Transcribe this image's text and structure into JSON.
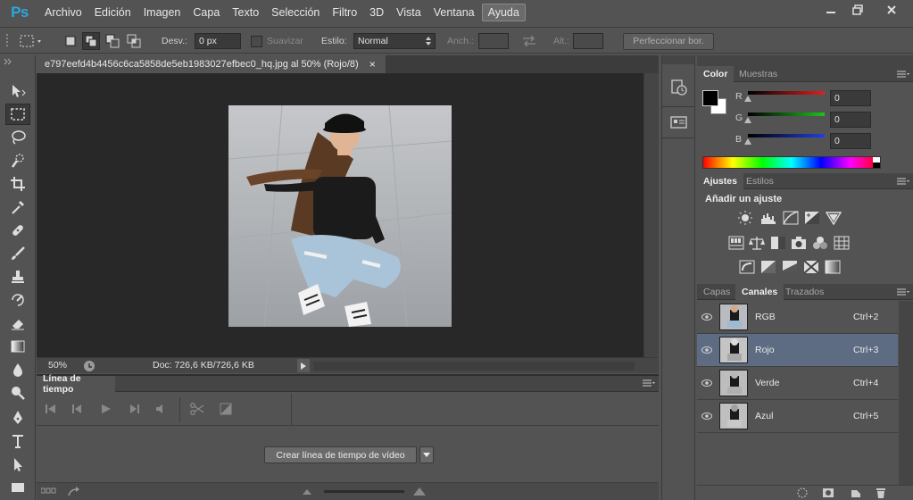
{
  "app": {
    "logo": "Ps"
  },
  "menu": [
    "Archivo",
    "Edición",
    "Imagen",
    "Capa",
    "Texto",
    "Selección",
    "Filtro",
    "3D",
    "Vista",
    "Ventana",
    "Ayuda"
  ],
  "menu_active": "Ayuda",
  "options": {
    "desv_label": "Desv.:",
    "desv_value": "0 px",
    "suavizar_label": "Suavizar",
    "estilo_label": "Estilo:",
    "estilo_value": "Normal",
    "anch_label": "Anch.:",
    "alt_label": "Alt.:",
    "refine_label": "Perfeccionar bor."
  },
  "document": {
    "tab_title": "e797eefd4b4456c6ca5858de5eb1983027efbec0_hq.jpg al 50% (Rojo/8)",
    "close_glyph": "×"
  },
  "status": {
    "zoom": "50%",
    "doc_info": "Doc: 726,6 KB/726,6 KB"
  },
  "timeline": {
    "tab": "Línea de tiempo",
    "create_button": "Crear línea de tiempo de vídeo"
  },
  "color_panel": {
    "tabs": [
      "Color",
      "Muestras"
    ],
    "active_tab": "Color",
    "channels": [
      {
        "label": "R",
        "value": "0",
        "color": "#e02020"
      },
      {
        "label": "G",
        "value": "0",
        "color": "#20c020"
      },
      {
        "label": "B",
        "value": "0",
        "color": "#2040e0"
      }
    ]
  },
  "adjustments_panel": {
    "tabs": [
      "Ajustes",
      "Estilos"
    ],
    "active_tab": "Ajustes",
    "heading": "Añadir un ajuste",
    "icons_row1": [
      "brightness-icon",
      "levels-icon",
      "curves-icon",
      "exposure-icon",
      "vibrance-icon"
    ],
    "icons_row2": [
      "hue-saturation-icon",
      "color-balance-icon",
      "black-white-icon",
      "photo-filter-icon",
      "channel-mixer-icon",
      "color-lookup-icon"
    ],
    "icons_row3": [
      "invert-icon",
      "posterize-icon",
      "threshold-icon",
      "selective-color-icon",
      "gradient-map-icon"
    ]
  },
  "channels_panel": {
    "tabs": [
      "Capas",
      "Canales",
      "Trazados"
    ],
    "active_tab": "Canales",
    "rows": [
      {
        "name": "RGB",
        "shortcut": "Ctrl+2",
        "selected": false
      },
      {
        "name": "Rojo",
        "shortcut": "Ctrl+3",
        "selected": true
      },
      {
        "name": "Verde",
        "shortcut": "Ctrl+4",
        "selected": false
      },
      {
        "name": "Azul",
        "shortcut": "Ctrl+5",
        "selected": false
      }
    ]
  },
  "colors": {
    "accent": "#29a8e0",
    "selected_row": "#5d6c82",
    "canvas_bg": "#282828"
  }
}
